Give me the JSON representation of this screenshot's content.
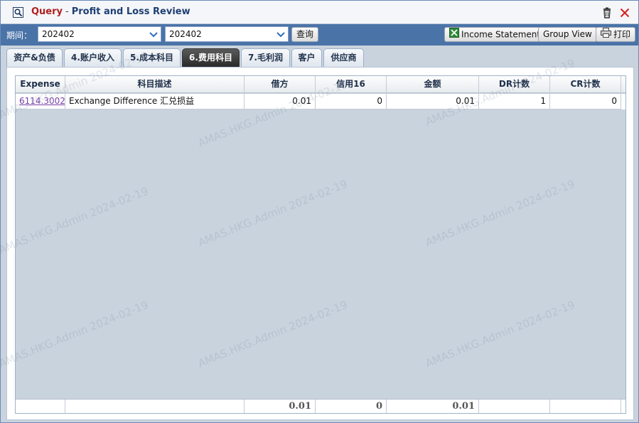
{
  "window": {
    "title_query": "Query",
    "title_separator": "-",
    "title_main": "Profit and Loss Review"
  },
  "toolbar": {
    "period_label": "期间：",
    "period_from": "202402",
    "period_to": "202402",
    "query_button": "查询",
    "income_statement_button": "Income Statement",
    "group_view_button": "Group View",
    "print_button": "打印"
  },
  "tabs": [
    {
      "label": "资产&负债",
      "active": false
    },
    {
      "label": "4.账户收入",
      "active": false
    },
    {
      "label": "5.成本科目",
      "active": false
    },
    {
      "label": "6.费用科目",
      "active": true
    },
    {
      "label": "7.毛利润",
      "active": false
    },
    {
      "label": "客户",
      "active": false
    },
    {
      "label": "供应商",
      "active": false
    }
  ],
  "grid": {
    "columns": [
      "Expense",
      "科目描述",
      "借方",
      "信用16",
      "金额",
      "DR计数",
      "CR计数"
    ],
    "rows": [
      {
        "expense": "6114.3002",
        "description": "Exchange Difference   汇兑损益",
        "debit": "0.01",
        "credit": "0",
        "amount": "0.01",
        "dr_count": "1",
        "cr_count": "0"
      }
    ],
    "totals": {
      "debit": "0.01",
      "credit": "0",
      "amount": "0.01"
    }
  },
  "watermark": "AMAS.HKG.Admin 2024-02-19",
  "colors": {
    "toolbar_bg": "#4a73a8",
    "title_query": "#b01e1e",
    "title_main": "#1f3f73",
    "grid_bg": "#c9d3de",
    "link": "#7a3fa6"
  }
}
